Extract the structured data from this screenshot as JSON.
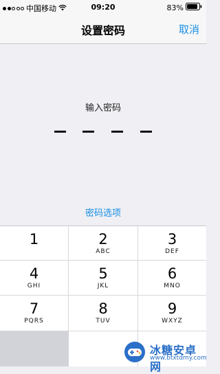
{
  "status_bar": {
    "carrier": "中国移动",
    "time": "09:20",
    "battery": "83%",
    "signal_bars_filled": 2,
    "signal_bars_total": 5
  },
  "nav": {
    "title": "设置密码",
    "cancel_label": "取消"
  },
  "passcode": {
    "prompt": "输入密码",
    "digits_total": 4,
    "digits_entered": 0
  },
  "options_link": "密码选项",
  "keypad": {
    "keys": [
      {
        "digit": "1",
        "letters": ""
      },
      {
        "digit": "2",
        "letters": "ABC"
      },
      {
        "digit": "3",
        "letters": "DEF"
      },
      {
        "digit": "4",
        "letters": "GHI"
      },
      {
        "digit": "5",
        "letters": "JKL"
      },
      {
        "digit": "6",
        "letters": "MNO"
      },
      {
        "digit": "7",
        "letters": "PQRS"
      },
      {
        "digit": "8",
        "letters": "TUV"
      },
      {
        "digit": "9",
        "letters": "WXYZ"
      }
    ]
  },
  "watermark": {
    "name": "冰糖安卓网",
    "url": "www.btxtdmy.com"
  },
  "colors": {
    "accent": "#1a8fe3",
    "background": "#efeff4",
    "keypad": "#ffffff",
    "watermark": "#2a6fc8"
  }
}
